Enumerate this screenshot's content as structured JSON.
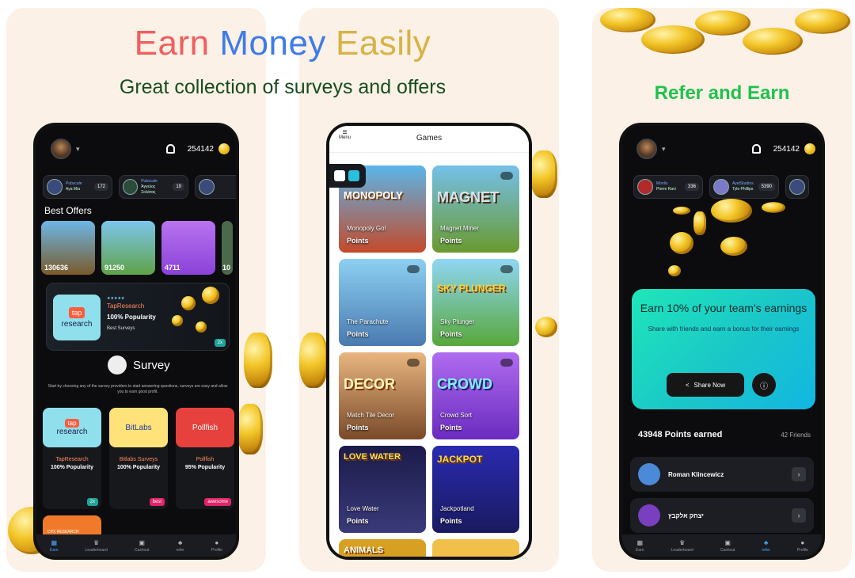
{
  "promo": {
    "headline_word1": "Earn",
    "headline_word2": "Money",
    "headline_word3": "Easily",
    "subtitle": "Great collection of surveys and offers",
    "refer_title": "Refer and Earn",
    "colors": {
      "word1": "#f25e5e",
      "word2": "#3f7be8",
      "word3": "#d7b346",
      "subtitle": "#184d1f",
      "refer": "#1fc24e"
    }
  },
  "earn_screen": {
    "points": "254142",
    "chips": [
      {
        "top": "Pubscale",
        "name": "Aya Mia",
        "num": "172"
      },
      {
        "top": "Pubscale",
        "name": "Άγγελος Σολάτας",
        "num": "19"
      },
      {
        "top": "",
        "name": "",
        "num": ""
      }
    ],
    "best_offers_title": "Best Offers",
    "offers": [
      {
        "value": "130636",
        "color": "#7a5a2a"
      },
      {
        "value": "91250",
        "color": "#5fa248"
      },
      {
        "value": "4711",
        "color": "#8a42d8"
      },
      {
        "value": "10",
        "color": "#4b6a4b"
      }
    ],
    "banner": {
      "logo_top": "tap",
      "logo_bottom": "research",
      "stars": "★★★★★",
      "name": "TapResearch",
      "popularity": "100% Popularity",
      "tag": "Best Surveys",
      "badge": "2x"
    },
    "survey_title": "Survey",
    "survey_desc": "Start by choosing any of the survey providers to start answering questions, surveys are easy and allow you to earn good profit.",
    "surveys": [
      {
        "logo": "research",
        "name": "TapResearch",
        "pop": "100% Popularity",
        "badge": "2x",
        "bg": "#8fe0ec"
      },
      {
        "logo": "BitLabs",
        "name": "Bitlabs Surveys",
        "pop": "100% Popularity",
        "badge": "best",
        "bg": "#ffe27a"
      },
      {
        "logo": "Pollfish",
        "name": "Pollfish",
        "pop": "95% Popularity",
        "badge": "awesome",
        "bg": "#e6413c"
      }
    ],
    "cpx": "CPX RESEARCH",
    "nav": [
      "Earn",
      "Leaderboard",
      "Cashout",
      "refer",
      "Profile"
    ]
  },
  "games_screen": {
    "menu_label": "Menu",
    "title": "Games",
    "games": [
      {
        "name": "Monopoly Go!",
        "points": "Points",
        "big": "MONOPOLY",
        "bg": "#3aa0d8"
      },
      {
        "name": "Magnet Miner",
        "points": "Points",
        "big": "MAGNET",
        "bg": "#6a9a2e"
      },
      {
        "name": "The Parachute",
        "points": "Points",
        "big": "",
        "bg": "#69b6e8"
      },
      {
        "name": "Sky Plunger",
        "points": "Points",
        "big": "SKY PLUNGER",
        "bg": "#58a83a"
      },
      {
        "name": "Match Tile Decor",
        "points": "Points",
        "big": "DECOR",
        "bg": "#a7784a"
      },
      {
        "name": "Crowd Sort",
        "points": "Points",
        "big": "CROWD",
        "bg": "#8b44de"
      },
      {
        "name": "Love Water",
        "points": "Points",
        "big": "LOVE WATER",
        "bg": "#2b2a6a"
      },
      {
        "name": "Jackpotland",
        "points": "Points",
        "big": "JACKPOT",
        "bg": "#3a2fb0"
      },
      {
        "name": "",
        "points": "",
        "big": "ANIMALS",
        "bg": "#d8a022"
      },
      {
        "name": "",
        "points": "",
        "big": "",
        "bg": "#f0c04a"
      }
    ]
  },
  "refer_screen": {
    "points": "254142",
    "chips": [
      {
        "top": "Monlix",
        "name": "Pierre Ravi",
        "num": "336"
      },
      {
        "top": "AyetStudios",
        "name": "Tyle Phillips",
        "num": "5390"
      }
    ],
    "card_title": "Earn 10% of your team's earnings",
    "card_text": "Share with friends and earn a bonus for their earnings",
    "share_label": "Share Now",
    "points_earned": "43948 Points earned",
    "friends_count": "42 Friends",
    "friends": [
      {
        "name": "Roman Klincewicz",
        "color": "#4a8ad8"
      },
      {
        "name": "יצחק אלקבץ",
        "color": "#7a3fc0"
      }
    ],
    "nav": [
      "Earn",
      "Leaderboard",
      "Cashout",
      "refer",
      "Profile"
    ]
  }
}
